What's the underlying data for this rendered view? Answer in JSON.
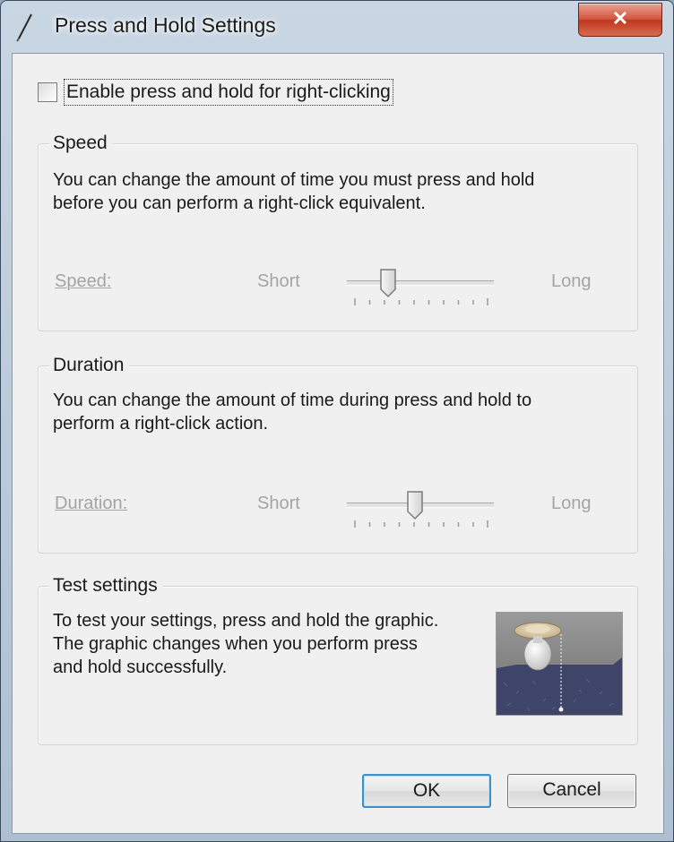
{
  "window": {
    "title": "Press and Hold Settings",
    "close_label": "✕"
  },
  "enable": {
    "label": "Enable press and hold for right-clicking",
    "checked": false
  },
  "speed": {
    "group_title": "Speed",
    "description_line1": "You can change the amount of time you must press and hold",
    "description_line2": "before you can perform a right-click equivalent.",
    "label": "Speed:",
    "min_label": "Short",
    "max_label": "Long",
    "value_fraction": 0.25
  },
  "duration": {
    "group_title": "Duration",
    "description_line1": "You can change the amount of time during press and hold to",
    "description_line2": "perform a right-click action.",
    "label": "Duration:",
    "min_label": "Short",
    "max_label": "Long",
    "value_fraction": 0.45
  },
  "test": {
    "group_title": "Test settings",
    "description_line1": "To test your settings, press and hold the graphic.",
    "description_line2": "The graphic changes when you perform press",
    "description_line3": "and hold successfully."
  },
  "buttons": {
    "ok_label": "OK",
    "cancel_label": "Cancel"
  },
  "colors": {
    "close_button": "#c0381f",
    "ok_border": "#3c90c8",
    "disabled_text": "#a4a4a4"
  }
}
